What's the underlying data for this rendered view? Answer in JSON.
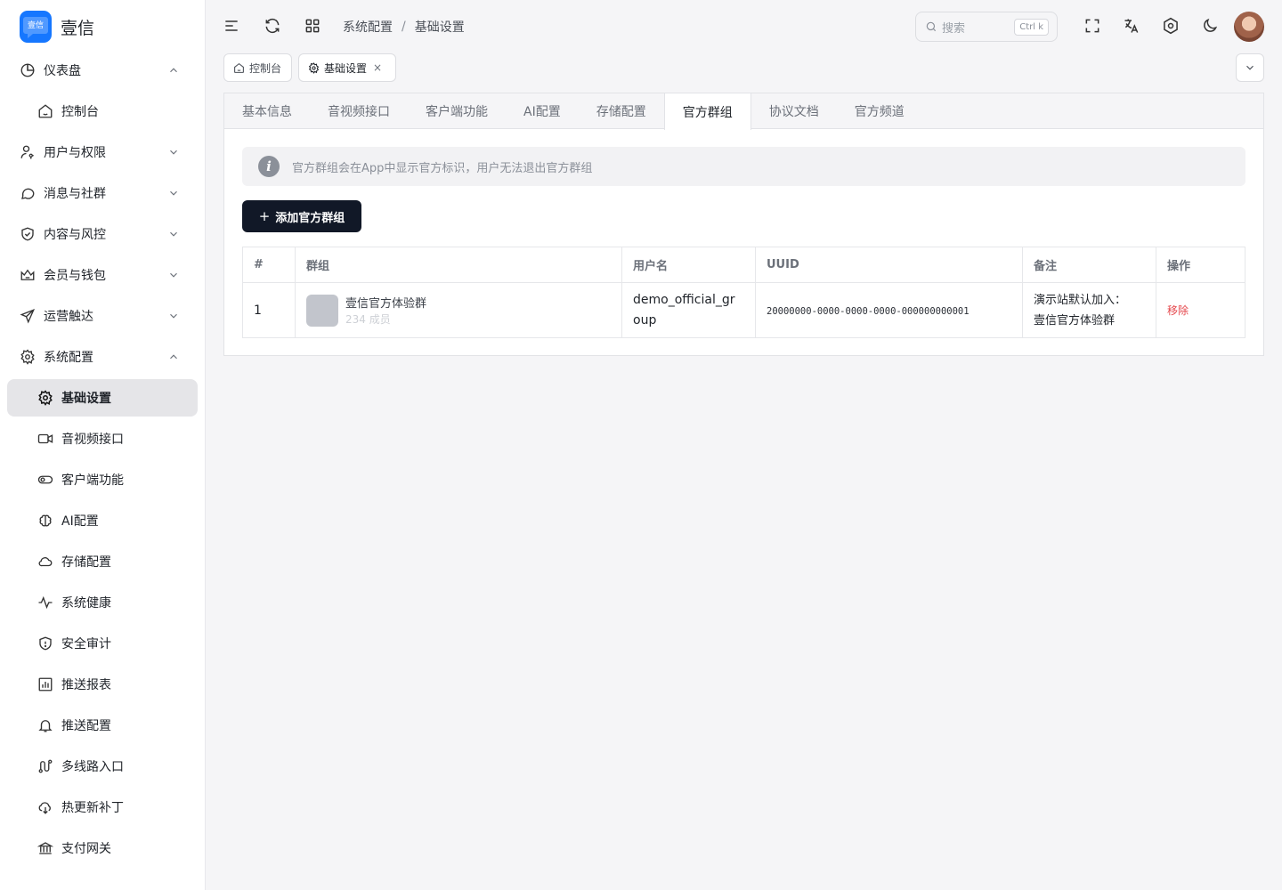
{
  "brand": {
    "name": "壹信",
    "logo_text": "壹信",
    "accent": "#1677ff"
  },
  "sidebar": {
    "items": [
      {
        "label": "仪表盘",
        "icon": "pie-chart-icon",
        "expanded": true
      },
      {
        "label": "控制台",
        "icon": "home-icon",
        "sub": true
      },
      {
        "label": "用户与权限",
        "icon": "user-key-icon",
        "expanded": false
      },
      {
        "label": "消息与社群",
        "icon": "chat-bubble-icon",
        "expanded": false
      },
      {
        "label": "内容与风控",
        "icon": "shield-check-icon",
        "expanded": false
      },
      {
        "label": "会员与钱包",
        "icon": "crown-icon",
        "expanded": false
      },
      {
        "label": "运营触达",
        "icon": "send-icon",
        "expanded": false
      },
      {
        "label": "系统配置",
        "icon": "gear-icon",
        "expanded": true
      },
      {
        "label": "基础设置",
        "icon": "gear-icon",
        "sub": true,
        "active": true
      },
      {
        "label": "音视频接口",
        "icon": "video-icon",
        "sub": true
      },
      {
        "label": "客户端功能",
        "icon": "toggle-icon",
        "sub": true
      },
      {
        "label": "AI配置",
        "icon": "brain-icon",
        "sub": true
      },
      {
        "label": "存储配置",
        "icon": "cloud-icon",
        "sub": true
      },
      {
        "label": "系统健康",
        "icon": "pulse-icon",
        "sub": true
      },
      {
        "label": "安全审计",
        "icon": "shield-icon",
        "sub": true
      },
      {
        "label": "推送报表",
        "icon": "bar-chart-icon",
        "sub": true
      },
      {
        "label": "推送配置",
        "icon": "bell-icon",
        "sub": true
      },
      {
        "label": "多线路入口",
        "icon": "route-icon",
        "sub": true
      },
      {
        "label": "热更新补丁",
        "icon": "cloud-download-icon",
        "sub": true
      },
      {
        "label": "支付网关",
        "icon": "bank-icon",
        "sub": true
      }
    ]
  },
  "header": {
    "breadcrumb": [
      "系统配置",
      "基础设置"
    ],
    "search": {
      "placeholder": "搜索",
      "shortcut": "Ctrl k"
    }
  },
  "page_tabs": [
    {
      "label": "控制台",
      "icon": "home-icon"
    },
    {
      "label": "基础设置",
      "icon": "gear-icon",
      "active": true,
      "closable": true,
      "close_glyph": "×"
    }
  ],
  "settings_tabs": [
    {
      "label": "基本信息"
    },
    {
      "label": "音视频接口"
    },
    {
      "label": "客户端功能"
    },
    {
      "label": "AI配置"
    },
    {
      "label": "存储配置"
    },
    {
      "label": "官方群组",
      "active": true
    },
    {
      "label": "协议文档"
    },
    {
      "label": "官方频道"
    }
  ],
  "notice": {
    "icon": "info-icon",
    "glyph": "i",
    "text": "官方群组会在App中显示官方标识，用户无法退出官方群组"
  },
  "add_button": {
    "plus": "+",
    "label": "添加官方群组"
  },
  "table": {
    "columns": [
      "#",
      "群组",
      "用户名",
      "UUID",
      "备注",
      "操作"
    ],
    "rows": [
      {
        "index": "1",
        "group_name": "壹信官方体验群",
        "member_count": "234 成员",
        "username": "demo_official_group",
        "uuid": "20000000-0000-0000-0000-000000000001",
        "remark": "演示站默认加入：壹信官方体验群",
        "action": "移除"
      }
    ]
  },
  "colors": {
    "danger": "#e5484d",
    "primary_button": "#111827"
  }
}
